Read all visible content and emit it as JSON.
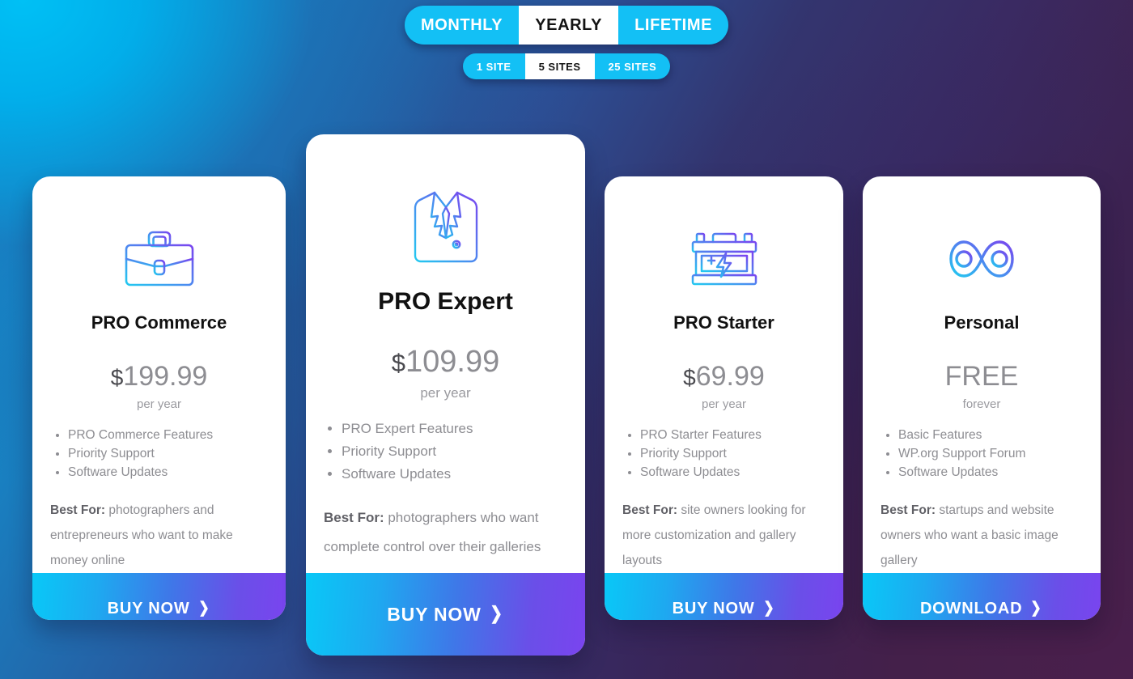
{
  "billing_toggle": {
    "options": [
      "MONTHLY",
      "YEARLY",
      "LIFETIME"
    ],
    "selected": "YEARLY"
  },
  "sites_toggle": {
    "options": [
      "1 SITE",
      "5 SITES",
      "25 SITES"
    ],
    "selected": "5 SITES"
  },
  "colors": {
    "toggle_bg": "#13c0f5",
    "toggle_active_bg": "#ffffff",
    "toggle_active_text": "#131313",
    "cta_gradient_start": "#09c8f7",
    "cta_gradient_end": "#7a44ef",
    "icon_gradient_start": "#22c9f0",
    "icon_gradient_end": "#7a44ef",
    "bg_top_left": "#00b4ed",
    "bg_bottom_right": "#411c43",
    "card_bg": "#ffffff",
    "plan_name": "#111111",
    "price_text": "#8d8d92",
    "body_text": "#8d8d92"
  },
  "plans": [
    {
      "id": "pro-commerce",
      "icon": "briefcase-icon",
      "name": "PRO Commerce",
      "currency": "$",
      "amount": "199.99",
      "period": "per year",
      "features": [
        "PRO Commerce Features",
        "Priority Support",
        "Software Updates"
      ],
      "best_for_label": "Best For:",
      "best_for_text": " photographers and entrepreneurs who want to make money online",
      "cta_label": "BUY NOW",
      "cta_chevron": "❯",
      "featured": false
    },
    {
      "id": "pro-expert",
      "icon": "suit-jacket-icon",
      "name": "PRO Expert",
      "currency": "$",
      "amount": "109.99",
      "period": "per year",
      "features": [
        "PRO Expert Features",
        "Priority Support",
        "Software Updates"
      ],
      "best_for_label": "Best For:",
      "best_for_text": " photographers who want complete control over their galleries",
      "cta_label": "BUY NOW",
      "cta_chevron": "❯",
      "featured": true
    },
    {
      "id": "pro-starter",
      "icon": "battery-icon",
      "name": "PRO Starter",
      "currency": "$",
      "amount": "69.99",
      "period": "per year",
      "features": [
        "PRO Starter Features",
        "Priority Support",
        "Software Updates"
      ],
      "best_for_label": "Best For:",
      "best_for_text": " site owners looking for more customization and gallery layouts",
      "cta_label": "BUY NOW",
      "cta_chevron": "❯",
      "featured": false
    },
    {
      "id": "personal",
      "icon": "infinity-icon",
      "name": "Personal",
      "currency": "",
      "amount": "FREE",
      "period": "forever",
      "features": [
        "Basic Features",
        "WP.org Support Forum",
        "Software Updates"
      ],
      "best_for_label": "Best For:",
      "best_for_text": " startups and website owners who want a basic image gallery",
      "cta_label": "DOWNLOAD",
      "cta_chevron": "❯",
      "featured": false
    }
  ]
}
